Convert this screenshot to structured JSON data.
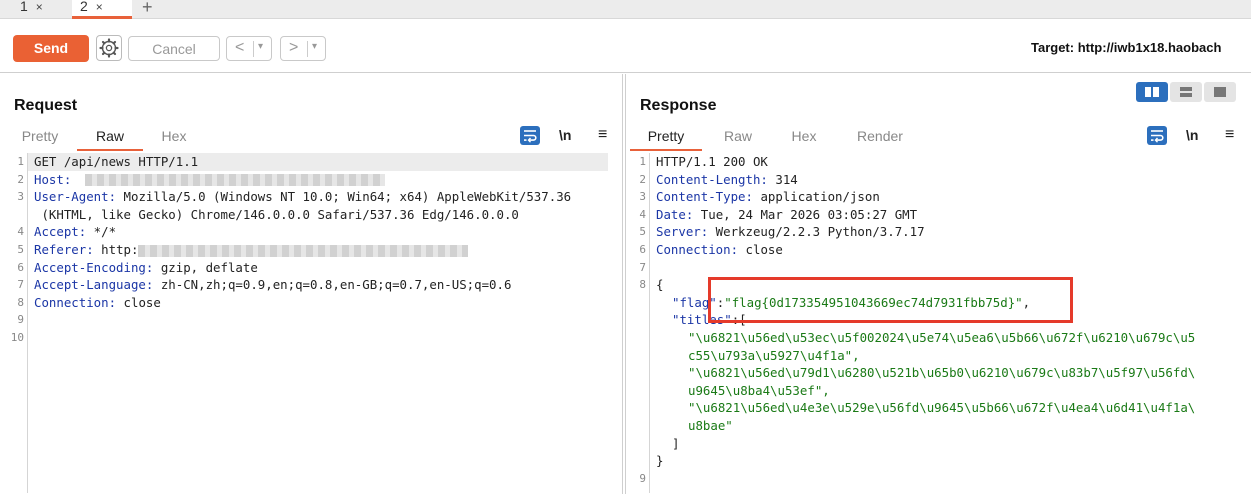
{
  "tabs": [
    {
      "label": "1",
      "close": "×"
    },
    {
      "label": "2",
      "close": "×"
    }
  ],
  "tab_add": "+",
  "toolbar": {
    "send_label": "Send",
    "cancel_label": "Cancel",
    "back_arrow": "<",
    "forward_arrow": ">",
    "dropdown_caret": "▾",
    "target_text": "Target: http://iwb1x18.haobach"
  },
  "request": {
    "title": "Request",
    "tabs": [
      "Pretty",
      "Raw",
      "Hex"
    ],
    "active_tab": "Raw",
    "tools": {
      "newline": "\\n",
      "menu": "≡"
    },
    "lines": [
      {
        "num": "1",
        "key": "",
        "text": "GET /api/news HTTP/1.1"
      },
      {
        "num": "2",
        "key": "Host:",
        "text": " "
      },
      {
        "num": "3",
        "key": "User-Agent:",
        "text": " Mozilla/5.0 (Windows NT 10.0; Win64; x64) AppleWebKit/537.36"
      },
      {
        "num": "",
        "key": "",
        "text": " (KHTML, like Gecko) Chrome/146.0.0.0 Safari/537.36 Edg/146.0.0.0"
      },
      {
        "num": "4",
        "key": "Accept:",
        "text": " */*"
      },
      {
        "num": "5",
        "key": "Referer:",
        "text": " http:"
      },
      {
        "num": "6",
        "key": "Accept-Encoding:",
        "text": " gzip, deflate"
      },
      {
        "num": "7",
        "key": "Accept-Language:",
        "text": " zh-CN,zh;q=0.9,en;q=0.8,en-GB;q=0.7,en-US;q=0.6"
      },
      {
        "num": "8",
        "key": "Connection:",
        "text": " close"
      },
      {
        "num": "9",
        "key": "",
        "text": ""
      },
      {
        "num": "10",
        "key": "",
        "text": ""
      }
    ]
  },
  "response": {
    "title": "Response",
    "tabs": [
      "Pretty",
      "Raw",
      "Hex",
      "Render"
    ],
    "active_tab": "Pretty",
    "tools": {
      "newline": "\\n",
      "menu": "≡"
    },
    "lines": [
      {
        "num": "1",
        "key": "",
        "text": "HTTP/1.1 200 OK"
      },
      {
        "num": "2",
        "key": "Content-Length:",
        "text": " 314"
      },
      {
        "num": "3",
        "key": "Content-Type:",
        "text": " application/json"
      },
      {
        "num": "4",
        "key": "Date:",
        "text": " Tue, 24 Mar 2026 03:05:27 GMT"
      },
      {
        "num": "5",
        "key": "Server:",
        "text": " Werkzeug/2.2.3 Python/3.7.17"
      },
      {
        "num": "6",
        "key": "Connection:",
        "text": " close"
      },
      {
        "num": "7",
        "key": "",
        "text": ""
      },
      {
        "num": "8",
        "key": "",
        "text": "{"
      }
    ],
    "json": {
      "flag_key": "\"flag\"",
      "flag_value": "\"flag{0d173354951043669ec74d7931fbb75d}\"",
      "titles_key": "\"titles\"",
      "titles": [
        "\"\\u6821\\u56ed\\u53ec\\u5f002024\\u5e74\\u5ea6\\u5b66\\u672f\\u6210\\u679c\\u5",
        "c55\\u793a\\u5927\\u4f1a\",",
        "\"\\u6821\\u56ed\\u79d1\\u6280\\u521b\\u65b0\\u6210\\u679c\\u83b7\\u5f97\\u56fd\\",
        "u9645\\u8ba4\\u53ef\",",
        "\"\\u6821\\u56ed\\u4e3e\\u529e\\u56fd\\u9645\\u5b66\\u672f\\u4ea4\\u6d41\\u4f1a\\",
        "u8bae\""
      ],
      "close_bracket": "]",
      "close_brace": "}",
      "last_line_num": "9"
    }
  },
  "colors": {
    "accent": "#ea6134",
    "blue": "#2c6fbd",
    "highlight_box": "#e53a2a"
  }
}
